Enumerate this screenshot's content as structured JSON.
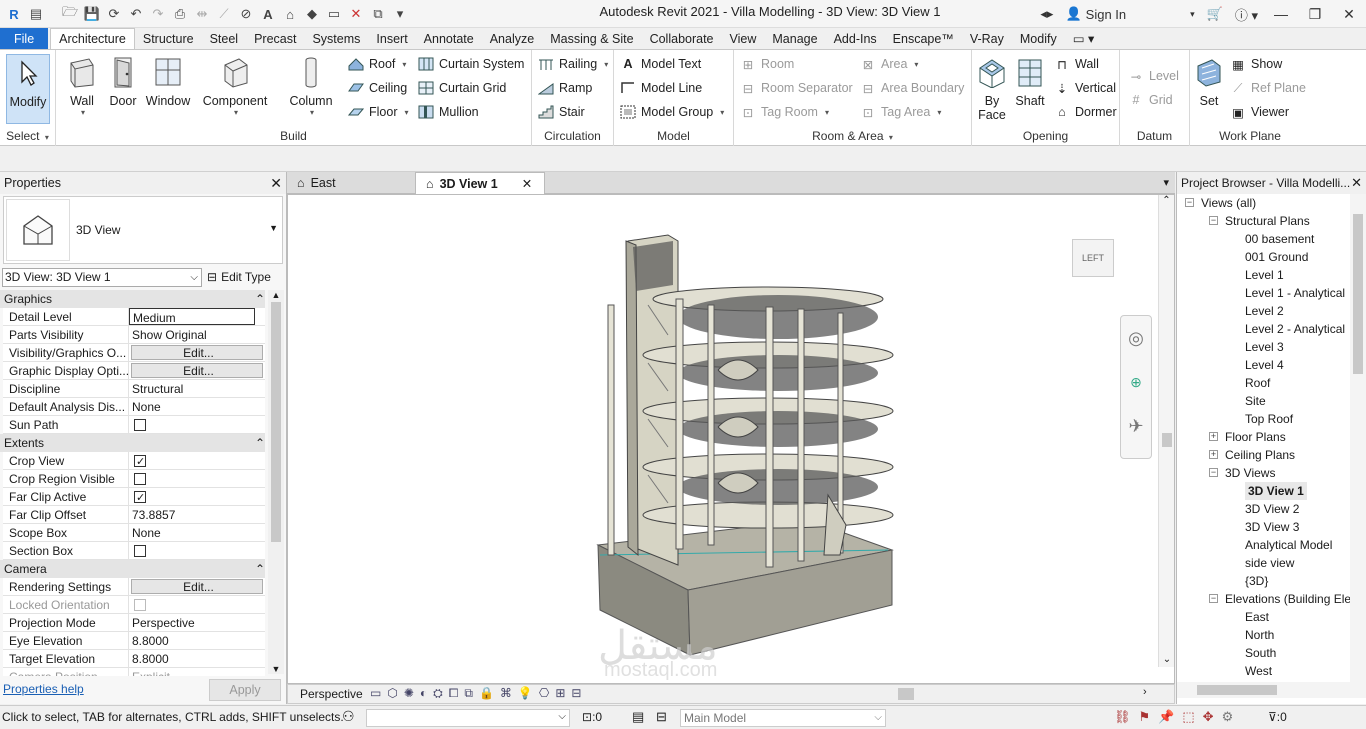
{
  "app": {
    "title": "Autodesk Revit 2021 - Villa Modelling - 3D View: 3D View 1",
    "sign_in": "Sign In"
  },
  "tabs": [
    "File",
    "Architecture",
    "Structure",
    "Steel",
    "Precast",
    "Systems",
    "Insert",
    "Annotate",
    "Analyze",
    "Massing & Site",
    "Collaborate",
    "View",
    "Manage",
    "Add-Ins",
    "Enscape™",
    "V-Ray",
    "Modify"
  ],
  "active_tab": "Architecture",
  "ribbon": {
    "select": {
      "modify": "Modify",
      "label": "Select"
    },
    "build": {
      "label": "Build",
      "wall": "Wall",
      "door": "Door",
      "window": "Window",
      "component": "Component",
      "column": "Column",
      "roof": "Roof",
      "ceiling": "Ceiling",
      "floor": "Floor",
      "curtain_system": "Curtain  System",
      "curtain_grid": "Curtain  Grid",
      "mullion": "Mullion"
    },
    "circulation": {
      "label": "Circulation",
      "railing": "Railing",
      "ramp": "Ramp",
      "stair": "Stair"
    },
    "model": {
      "label": "Model",
      "model_text": "Model  Text",
      "model_line": "Model  Line",
      "model_group": "Model  Group"
    },
    "room_area": {
      "label": "Room & Area",
      "room": "Room",
      "room_separator": "Room  Separator",
      "tag_room": "Tag  Room",
      "area": "Area",
      "area_boundary": "Area  Boundary",
      "tag_area": "Tag  Area"
    },
    "opening": {
      "label": "Opening",
      "by_face": "By Face",
      "shaft": "Shaft",
      "wall": "Wall",
      "vertical": "Vertical",
      "dormer": "Dormer"
    },
    "datum": {
      "label": "Datum",
      "level": "Level",
      "grid": "Grid"
    },
    "work_plane": {
      "label": "Work Plane",
      "set": "Set",
      "show": "Show",
      "ref_plane": "Ref  Plane",
      "viewer": "Viewer"
    }
  },
  "properties": {
    "title": "Properties",
    "type_name": "3D View",
    "selector": "3D View: 3D View 1",
    "edit_type": "Edit Type",
    "help": "Properties help",
    "apply": "Apply",
    "categories": {
      "graphics": "Graphics",
      "extents": "Extents",
      "camera": "Camera"
    },
    "rows": [
      {
        "key": "Detail Level",
        "value": "Medium"
      },
      {
        "key": "Parts Visibility",
        "value": "Show Original"
      },
      {
        "key": "Visibility/Graphics O...",
        "value": "Edit..."
      },
      {
        "key": "Graphic Display Opti...",
        "value": "Edit..."
      },
      {
        "key": "Discipline",
        "value": "Structural"
      },
      {
        "key": "Default Analysis Dis...",
        "value": "None"
      },
      {
        "key": "Sun Path",
        "value": ""
      },
      {
        "key": "Crop View",
        "value": ""
      },
      {
        "key": "Crop Region Visible",
        "value": ""
      },
      {
        "key": "Far Clip Active",
        "value": ""
      },
      {
        "key": "Far Clip Offset",
        "value": "73.8857"
      },
      {
        "key": "Scope Box",
        "value": "None"
      },
      {
        "key": "Section Box",
        "value": ""
      },
      {
        "key": "Rendering Settings",
        "value": "Edit..."
      },
      {
        "key": "Locked Orientation",
        "value": ""
      },
      {
        "key": "Projection Mode",
        "value": "Perspective"
      },
      {
        "key": "Eye Elevation",
        "value": "8.8000"
      },
      {
        "key": "Target Elevation",
        "value": "8.8000"
      },
      {
        "key": "Camera Position",
        "value": "Explicit"
      }
    ]
  },
  "view_tabs": [
    {
      "label": "East"
    },
    {
      "label": "3D View 1"
    }
  ],
  "viewcube_label": "LEFT",
  "view_control": {
    "mode": "Perspective"
  },
  "browser": {
    "title": "Project Browser - Villa Modelli...",
    "views_all": "Views (all)",
    "structural_plans": "Structural Plans",
    "structural_items": [
      "00 basement",
      "001 Ground",
      "Level 1",
      "Level 1 - Analytical",
      "Level 2",
      "Level 2 - Analytical",
      "Level 3",
      "Level 4",
      "Roof",
      "Site",
      "Top Roof"
    ],
    "floor_plans": "Floor Plans",
    "ceiling_plans": "Ceiling Plans",
    "views_3d": "3D Views",
    "views_3d_items": [
      "3D View 1",
      "3D View 2",
      "3D View 3",
      "Analytical Model",
      "side view",
      "{3D}"
    ],
    "elevations": "Elevations (Building Elev",
    "elevation_items": [
      "East",
      "North",
      "South",
      "West"
    ]
  },
  "status": {
    "hint": "Click to select, TAB for alternates, CTRL adds, SHIFT unselects.",
    "count_a": ":0",
    "model": "Main Model",
    "filter_count": ":0"
  },
  "watermark": {
    "arabic": "مستقل",
    "latin": "mostaql.com"
  }
}
